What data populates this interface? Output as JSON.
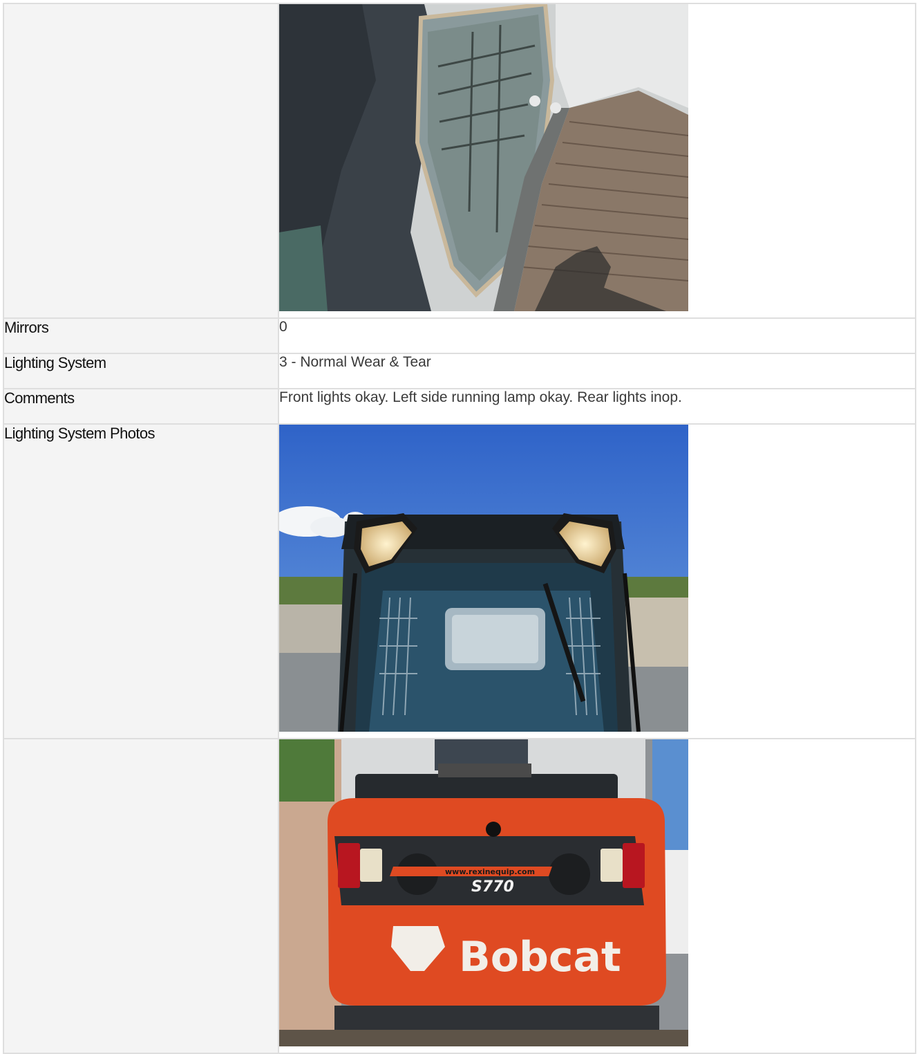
{
  "rows": [
    {
      "label": "",
      "photo": "mirror-photo"
    },
    {
      "label": "Mirrors",
      "value": "0"
    },
    {
      "label": "Lighting System",
      "value": "3 - Normal Wear & Tear"
    },
    {
      "label": "Comments",
      "value": "Front lights okay. Left side running lamp okay. Rear lights inop."
    },
    {
      "label": "Lighting System Photos",
      "photo": "front-lights-photo"
    },
    {
      "label": "",
      "photo": "rear-lights-photo"
    }
  ],
  "photo_text": {
    "model": "S770",
    "brand": "Bobcat",
    "url": "www.rexinequip.com"
  }
}
